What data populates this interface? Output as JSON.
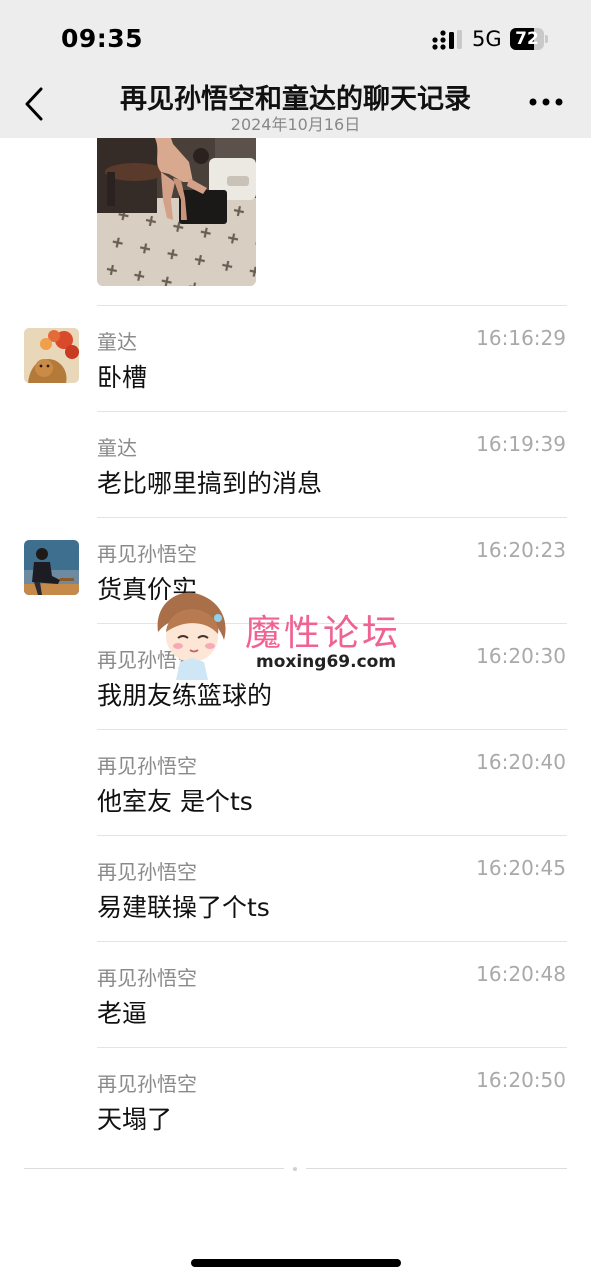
{
  "status_bar": {
    "time": "09:35",
    "network": "5G",
    "battery": "72",
    "battery_level": 0.72
  },
  "nav": {
    "title": "再见孙悟空和童达的聊天记录",
    "date": "2024年10月16日",
    "back_icon": "chevron-left-icon",
    "more_icon": "ellipsis-icon"
  },
  "messages": [
    {
      "sender": "童达",
      "time": "16:16:29",
      "text": "卧槽"
    },
    {
      "sender": "童达",
      "time": "16:19:39",
      "text": "老比哪里搞到的消息"
    },
    {
      "sender": "再见孙悟空",
      "time": "16:20:23",
      "text": "货真价实"
    },
    {
      "sender": "再见孙悟空",
      "time": "16:20:30",
      "text": "我朋友练篮球的"
    },
    {
      "sender": "再见孙悟空",
      "time": "16:20:40",
      "text": "他室友 是个ts"
    },
    {
      "sender": "再见孙悟空",
      "time": "16:20:45",
      "text": "易建联操了个ts"
    },
    {
      "sender": "再见孙悟空",
      "time": "16:20:48",
      "text": "老逼"
    },
    {
      "sender": "再见孙悟空",
      "time": "16:20:50",
      "text": "天塌了"
    }
  ],
  "watermark": {
    "name": "魔性论坛",
    "url": "moxing69.com"
  }
}
